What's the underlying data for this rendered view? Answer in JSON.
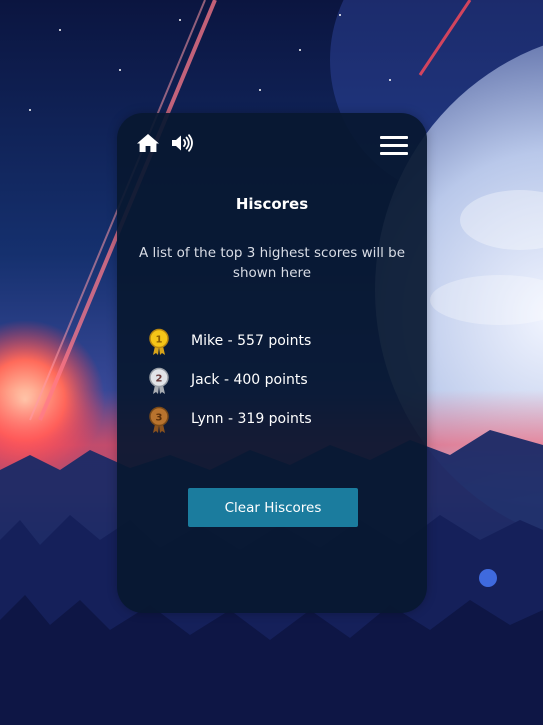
{
  "header": {
    "home_icon": "home-icon",
    "sound_icon": "speaker-volume-icon",
    "menu_icon": "hamburger-menu-icon"
  },
  "hiscores": {
    "title": "Hiscores",
    "description": "A list of the top 3 highest scores will be shown here",
    "entries": [
      {
        "rank": "1",
        "text": "Mike - 557 points",
        "medal": "gold-medal-icon"
      },
      {
        "rank": "2",
        "text": "Jack - 400 points",
        "medal": "silver-medal-icon"
      },
      {
        "rank": "3",
        "text": "Lynn - 319 points",
        "medal": "bronze-medal-icon"
      }
    ],
    "clear_label": "Clear Hiscores"
  },
  "colors": {
    "panel": "#081830",
    "button": "#1b7c9e",
    "gold": "#f5c518",
    "silver": "#c9ccd1",
    "bronze": "#b8732e"
  }
}
